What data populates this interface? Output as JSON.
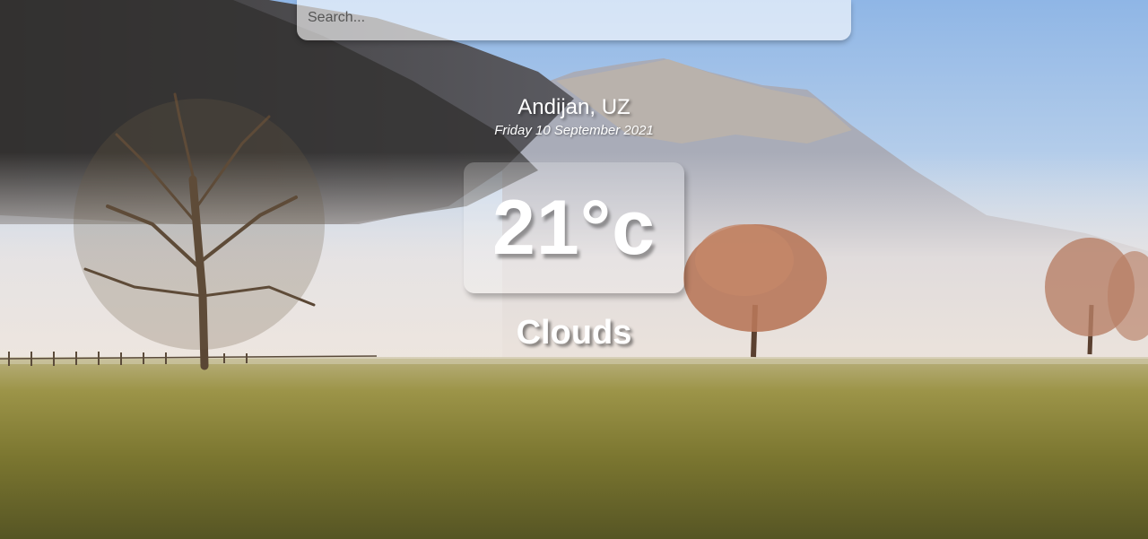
{
  "search": {
    "placeholder": "Search..."
  },
  "location": {
    "city": "Andijan, UZ"
  },
  "date": "Friday 10 September 2021",
  "weather": {
    "temperature": "21°c",
    "condition": "Clouds"
  },
  "background": {
    "image": "misty-mountain-meadow"
  }
}
